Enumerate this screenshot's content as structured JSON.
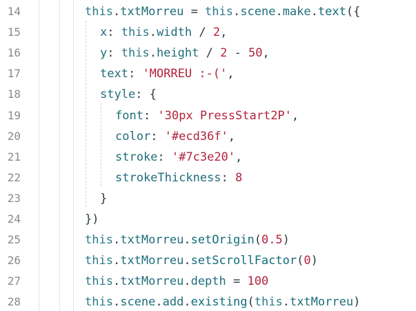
{
  "editor": {
    "lines": [
      {
        "no": "14",
        "indent": 0,
        "tokens": [
          {
            "t": "this",
            "c": "k"
          },
          {
            "t": ".",
            "c": "p"
          },
          {
            "t": "txtMorreu",
            "c": "prop"
          },
          {
            "t": " = ",
            "c": "op"
          },
          {
            "t": "this",
            "c": "k"
          },
          {
            "t": ".",
            "c": "p"
          },
          {
            "t": "scene",
            "c": "prop"
          },
          {
            "t": ".",
            "c": "p"
          },
          {
            "t": "make",
            "c": "prop"
          },
          {
            "t": ".",
            "c": "p"
          },
          {
            "t": "text",
            "c": "fn"
          },
          {
            "t": "({",
            "c": "p"
          }
        ]
      },
      {
        "no": "15",
        "indent": 1,
        "tokens": [
          {
            "t": "x",
            "c": "prop"
          },
          {
            "t": ": ",
            "c": "p"
          },
          {
            "t": "this",
            "c": "k"
          },
          {
            "t": ".",
            "c": "p"
          },
          {
            "t": "width",
            "c": "prop"
          },
          {
            "t": " / ",
            "c": "op"
          },
          {
            "t": "2",
            "c": "num"
          },
          {
            "t": ",",
            "c": "p"
          }
        ]
      },
      {
        "no": "16",
        "indent": 1,
        "tokens": [
          {
            "t": "y",
            "c": "prop"
          },
          {
            "t": ": ",
            "c": "p"
          },
          {
            "t": "this",
            "c": "k"
          },
          {
            "t": ".",
            "c": "p"
          },
          {
            "t": "height",
            "c": "prop"
          },
          {
            "t": " / ",
            "c": "op"
          },
          {
            "t": "2",
            "c": "num"
          },
          {
            "t": " - ",
            "c": "op"
          },
          {
            "t": "50",
            "c": "num"
          },
          {
            "t": ",",
            "c": "p"
          }
        ]
      },
      {
        "no": "17",
        "indent": 1,
        "tokens": [
          {
            "t": "text",
            "c": "prop"
          },
          {
            "t": ": ",
            "c": "p"
          },
          {
            "t": "'MORREU :-('",
            "c": "str"
          },
          {
            "t": ",",
            "c": "p"
          }
        ]
      },
      {
        "no": "18",
        "indent": 1,
        "tokens": [
          {
            "t": "style",
            "c": "prop"
          },
          {
            "t": ": {",
            "c": "p"
          }
        ]
      },
      {
        "no": "19",
        "indent": 2,
        "tokens": [
          {
            "t": "font",
            "c": "prop"
          },
          {
            "t": ": ",
            "c": "p"
          },
          {
            "t": "'30px PressStart2P'",
            "c": "str"
          },
          {
            "t": ",",
            "c": "p"
          }
        ]
      },
      {
        "no": "20",
        "indent": 2,
        "tokens": [
          {
            "t": "color",
            "c": "prop"
          },
          {
            "t": ": ",
            "c": "p"
          },
          {
            "t": "'#ecd36f'",
            "c": "str"
          },
          {
            "t": ",",
            "c": "p"
          }
        ]
      },
      {
        "no": "21",
        "indent": 2,
        "tokens": [
          {
            "t": "stroke",
            "c": "prop"
          },
          {
            "t": ": ",
            "c": "p"
          },
          {
            "t": "'#7c3e20'",
            "c": "str"
          },
          {
            "t": ",",
            "c": "p"
          }
        ]
      },
      {
        "no": "22",
        "indent": 2,
        "tokens": [
          {
            "t": "strokeThickness",
            "c": "prop"
          },
          {
            "t": ": ",
            "c": "p"
          },
          {
            "t": "8",
            "c": "num"
          }
        ]
      },
      {
        "no": "23",
        "indent": 1,
        "tokens": [
          {
            "t": "}",
            "c": "p"
          }
        ]
      },
      {
        "no": "24",
        "indent": 0,
        "tokens": [
          {
            "t": "})",
            "c": "p"
          }
        ]
      },
      {
        "no": "25",
        "indent": 0,
        "tokens": [
          {
            "t": "this",
            "c": "k"
          },
          {
            "t": ".",
            "c": "p"
          },
          {
            "t": "txtMorreu",
            "c": "prop"
          },
          {
            "t": ".",
            "c": "p"
          },
          {
            "t": "setOrigin",
            "c": "fn"
          },
          {
            "t": "(",
            "c": "p"
          },
          {
            "t": "0.5",
            "c": "num"
          },
          {
            "t": ")",
            "c": "p"
          }
        ]
      },
      {
        "no": "26",
        "indent": 0,
        "tokens": [
          {
            "t": "this",
            "c": "k"
          },
          {
            "t": ".",
            "c": "p"
          },
          {
            "t": "txtMorreu",
            "c": "prop"
          },
          {
            "t": ".",
            "c": "p"
          },
          {
            "t": "setScrollFactor",
            "c": "fn"
          },
          {
            "t": "(",
            "c": "p"
          },
          {
            "t": "0",
            "c": "num"
          },
          {
            "t": ")",
            "c": "p"
          }
        ]
      },
      {
        "no": "27",
        "indent": 0,
        "tokens": [
          {
            "t": "this",
            "c": "k"
          },
          {
            "t": ".",
            "c": "p"
          },
          {
            "t": "txtMorreu",
            "c": "prop"
          },
          {
            "t": ".",
            "c": "p"
          },
          {
            "t": "depth",
            "c": "prop"
          },
          {
            "t": " = ",
            "c": "op"
          },
          {
            "t": "100",
            "c": "num"
          }
        ]
      },
      {
        "no": "28",
        "indent": 0,
        "tokens": [
          {
            "t": "this",
            "c": "k"
          },
          {
            "t": ".",
            "c": "p"
          },
          {
            "t": "scene",
            "c": "prop"
          },
          {
            "t": ".",
            "c": "p"
          },
          {
            "t": "add",
            "c": "prop"
          },
          {
            "t": ".",
            "c": "p"
          },
          {
            "t": "existing",
            "c": "fn"
          },
          {
            "t": "(",
            "c": "p"
          },
          {
            "t": "this",
            "c": "k"
          },
          {
            "t": ".",
            "c": "p"
          },
          {
            "t": "txtMorreu",
            "c": "prop"
          },
          {
            "t": ")",
            "c": "p"
          }
        ]
      }
    ]
  },
  "colors": {
    "keyword": "#2b7a8a",
    "string": "#b3223b",
    "line_number": "#8a8a8a",
    "background": "#ffffff"
  }
}
